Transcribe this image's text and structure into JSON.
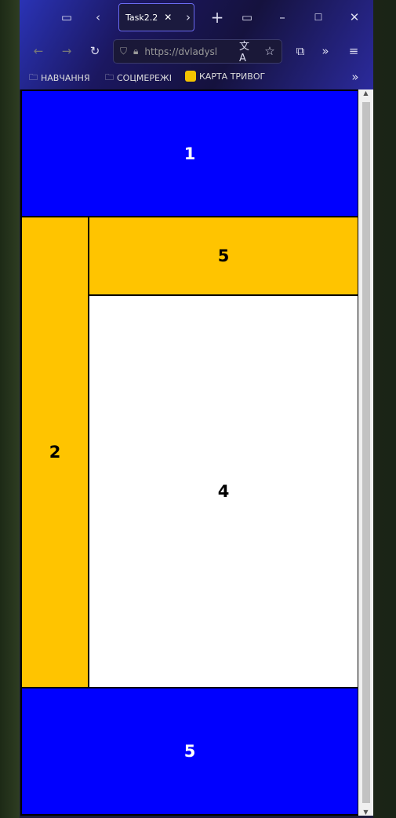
{
  "browser": {
    "tab_title": "Task2.2",
    "url": "https://dvladysl",
    "bookmarks": [
      "НАВЧАННЯ",
      "СОЦМЕРЕЖІ",
      "КАРТА ТРИВОГ"
    ]
  },
  "page": {
    "header": "1",
    "sidebar": "2",
    "top_bar": "5",
    "main": "4",
    "footer": "5"
  },
  "colors": {
    "blue": "#0000ff",
    "yellow": "#ffc400"
  }
}
